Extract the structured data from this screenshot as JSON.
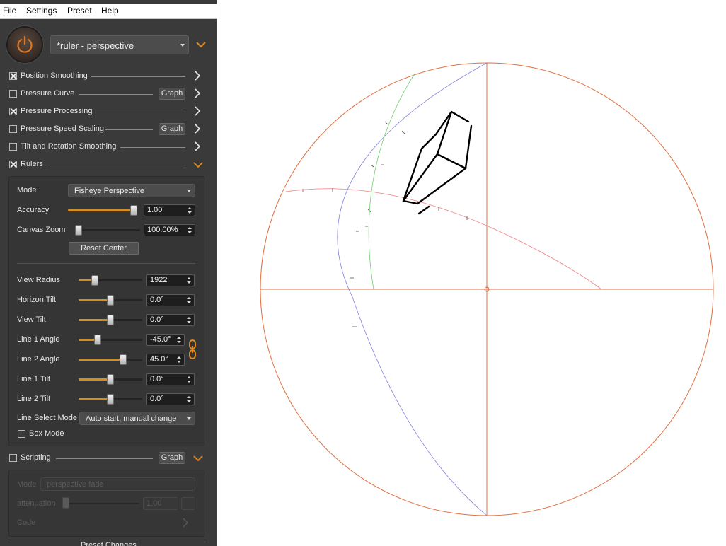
{
  "menu": [
    "File",
    "Settings",
    "Preset",
    "Help"
  ],
  "preset": {
    "name": "*ruler - perspective"
  },
  "filters": [
    {
      "label": "Position Smoothing",
      "checked": true,
      "graph": false
    },
    {
      "label": "Pressure Curve",
      "checked": false,
      "graph": true
    },
    {
      "label": "Pressure Processing",
      "checked": true,
      "graph": false
    },
    {
      "label": "Pressure Speed Scaling",
      "checked": false,
      "graph": true
    },
    {
      "label": "Tilt and Rotation Smoothing",
      "checked": false,
      "graph": false
    },
    {
      "label": "Rulers",
      "checked": true,
      "graph": false,
      "expanded": true
    }
  ],
  "graph_label": "Graph",
  "rulers": {
    "mode_label": "Mode",
    "mode_value": "Fisheye Perspective",
    "accuracy": {
      "label": "Accuracy",
      "value": "1.00",
      "level": 1.0
    },
    "canvas_zoom": {
      "label": "Canvas Zoom",
      "value": "100.00%",
      "level": 0.0
    },
    "reset_center": "Reset Center",
    "params": [
      {
        "label": "View Radius",
        "value": "1922",
        "level": 0.22
      },
      {
        "label": "Horizon Tilt",
        "value": "0.0°",
        "level": 0.5
      },
      {
        "label": "View Tilt",
        "value": "0.0°",
        "level": 0.5
      },
      {
        "label": "Line 1 Angle",
        "value": "-45.0°",
        "level": 0.28
      },
      {
        "label": "Line 2 Angle",
        "value": "45.0°",
        "level": 0.72
      },
      {
        "label": "Line 1 Tilt",
        "value": "0.0°",
        "level": 0.5
      },
      {
        "label": "Line 2 Tilt",
        "value": "0.0°",
        "level": 0.5
      }
    ],
    "line_select_label": "Line Select Mode",
    "line_select_value": "Auto start, manual change",
    "box_mode_label": "Box Mode",
    "box_mode_checked": false
  },
  "scripting": {
    "label": "Scripting",
    "checked": false,
    "mode_label": "Mode",
    "mode_value": "perspective fade",
    "attenuation_label": "attenuation",
    "attenuation_value": "1.00",
    "code_label": "Code"
  },
  "footer_label": "Preset Changes",
  "colors": {
    "accent": "#d68f1f",
    "circle": "#e07040",
    "blue_line": "#8080e0",
    "green_line": "#70d070",
    "red_line": "#f08080"
  }
}
